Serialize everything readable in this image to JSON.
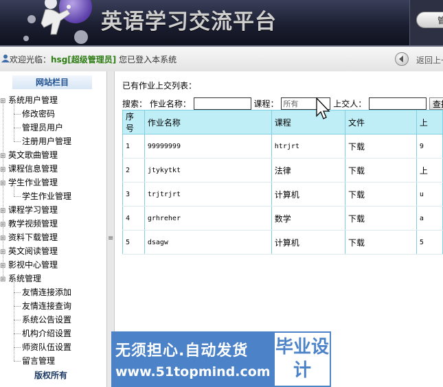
{
  "header": {
    "title": "英语学习交流平台",
    "manage_label": "管"
  },
  "welcome": {
    "prefix": "欢迎光临：",
    "username": "hsg[超级管理员]",
    "suffix": " 您已登入本系统",
    "back_label": "返回上一"
  },
  "sidebar": {
    "title": "网站栏目",
    "footer": "版权所有",
    "groups": [
      {
        "label": "系统用户管理",
        "children": [
          "修改密码",
          "管理员用户",
          "注册用户管理"
        ]
      },
      {
        "label": "英文歌曲管理",
        "children": []
      },
      {
        "label": "课程信息管理",
        "children": []
      },
      {
        "label": "学生作业管理",
        "children": [
          "学生作业管理"
        ]
      },
      {
        "label": "课程学习管理",
        "children": []
      },
      {
        "label": "教学视频管理",
        "children": []
      },
      {
        "label": "资料下载管理",
        "children": []
      },
      {
        "label": "英文阅读管理",
        "children": []
      },
      {
        "label": "影视中心管理",
        "children": []
      },
      {
        "label": "系统管理",
        "children": [
          "友情连接添加",
          "友情连接查询",
          "系统公告设置",
          "机构介绍设置",
          "师资队伍设置",
          "留言管理"
        ]
      }
    ]
  },
  "main": {
    "heading": "已有作业上交列表：",
    "search": {
      "label": "搜索：",
      "name_label": "作业名称：",
      "name_value": "",
      "course_label": "课程：",
      "course_value": "所有",
      "submitter_label": "上交人：",
      "submitter_value": "",
      "button_label": "查找"
    },
    "table": {
      "headers": [
        "序号",
        "作业名称",
        "课程",
        "文件",
        "上"
      ],
      "rows": [
        [
          "1",
          "99999999",
          "htrjrt",
          "下载",
          "9"
        ],
        [
          "2",
          "jtykytkt",
          "法律",
          "下载",
          "上"
        ],
        [
          "3",
          "trjtrjrt",
          "计算机",
          "下载",
          "u"
        ],
        [
          "4",
          "grhreher",
          "数学",
          "下载",
          "a"
        ],
        [
          "5",
          "dsagw",
          "计算机",
          "下载",
          "5"
        ]
      ]
    }
  },
  "watermark": {
    "line1": "无须担心.自动发货",
    "line2": "www.51topmind.com",
    "right": "毕业设计"
  }
}
